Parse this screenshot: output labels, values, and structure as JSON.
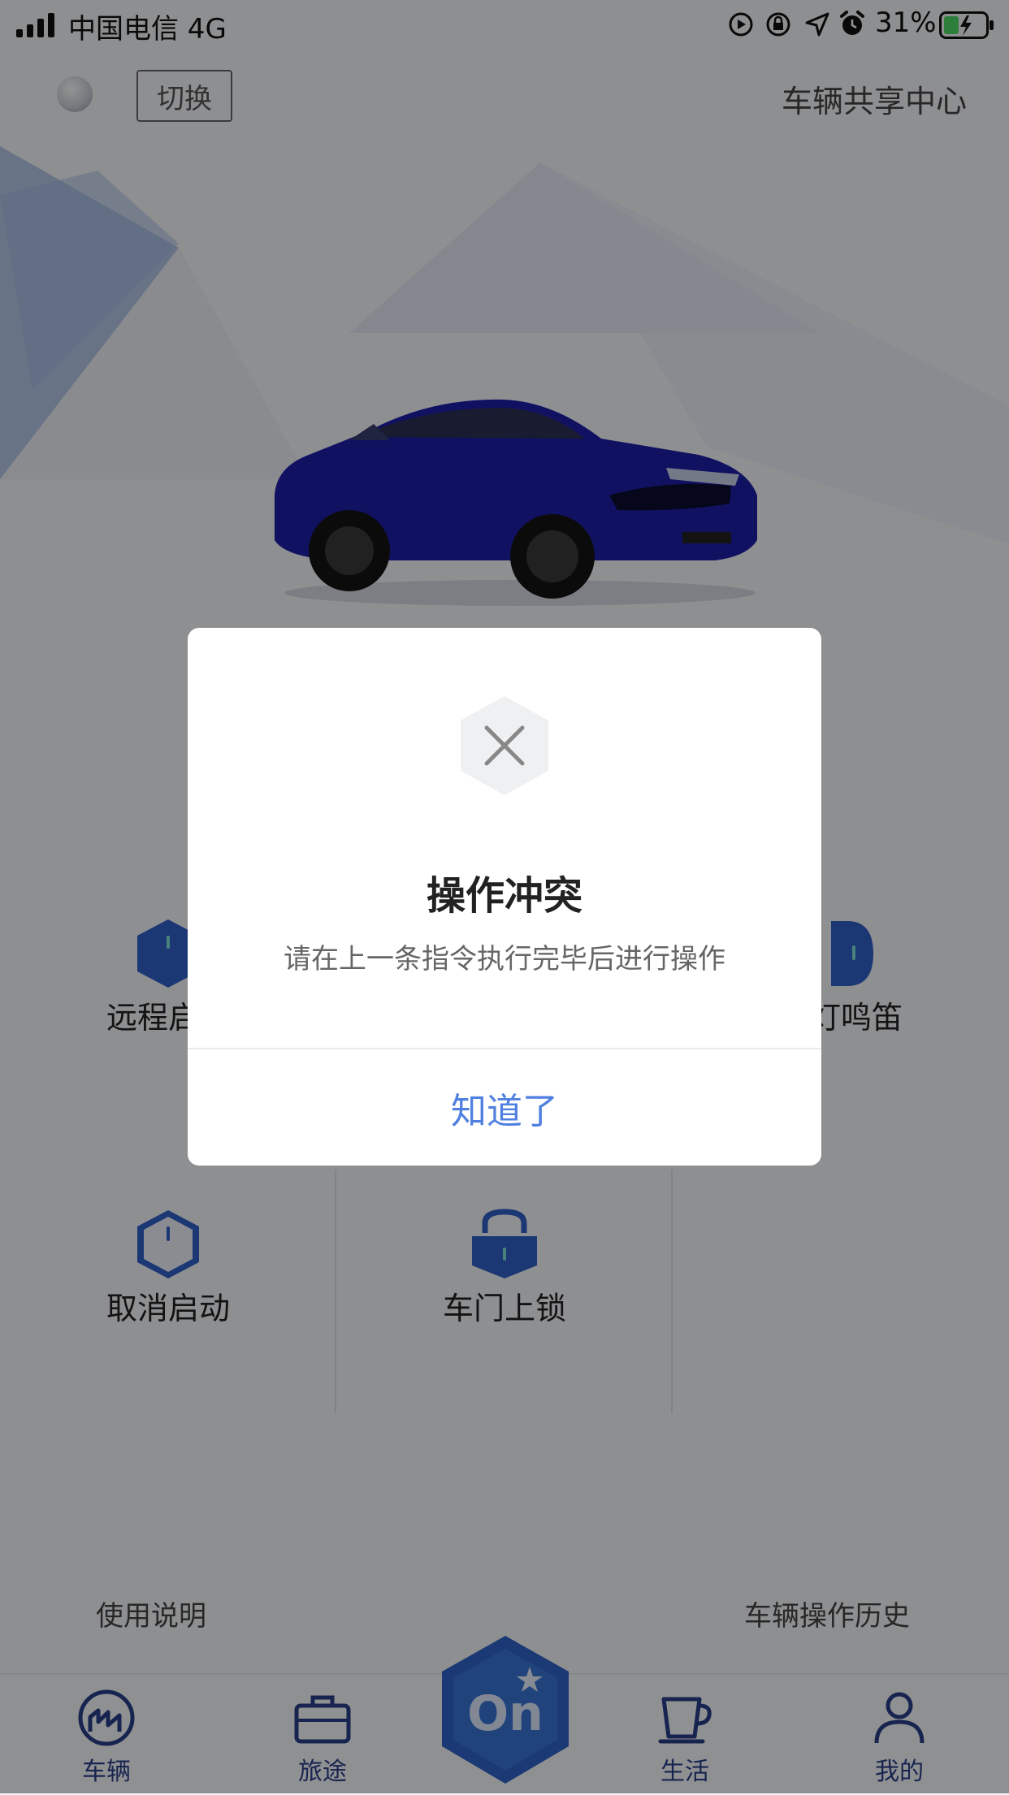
{
  "status_bar": {
    "carrier": "中国电信   4G",
    "battery_percent": "31%"
  },
  "header": {
    "switch_label": "切换",
    "title": "车辆共享中心"
  },
  "controls": [
    {
      "label": "远程启动",
      "icon": "engine-start-icon"
    },
    {
      "label": "闪灯鸣笛",
      "icon": "flash-horn-icon"
    },
    {
      "label": "取消启动",
      "icon": "cancel-start-icon"
    },
    {
      "label": "车门上锁",
      "icon": "lock-icon"
    }
  ],
  "links": {
    "manual": "使用说明",
    "history": "车辆操作历史"
  },
  "tabbar": {
    "items": [
      {
        "label": "车辆",
        "icon": "vehicle-icon"
      },
      {
        "label": "旅途",
        "icon": "briefcase-icon"
      },
      {
        "label": "生活",
        "icon": "cup-icon"
      },
      {
        "label": "我的",
        "icon": "person-icon"
      }
    ],
    "center": "On"
  },
  "dialog": {
    "icon": "close-icon",
    "title": "操作冲突",
    "message": "请在上一条指令执行完毕后进行操作",
    "button": "知道了"
  },
  "colors": {
    "accent": "#4f7fe0",
    "brand_blue": "#2a3f8a",
    "overlay": "rgba(0,0,0,0.42)"
  }
}
